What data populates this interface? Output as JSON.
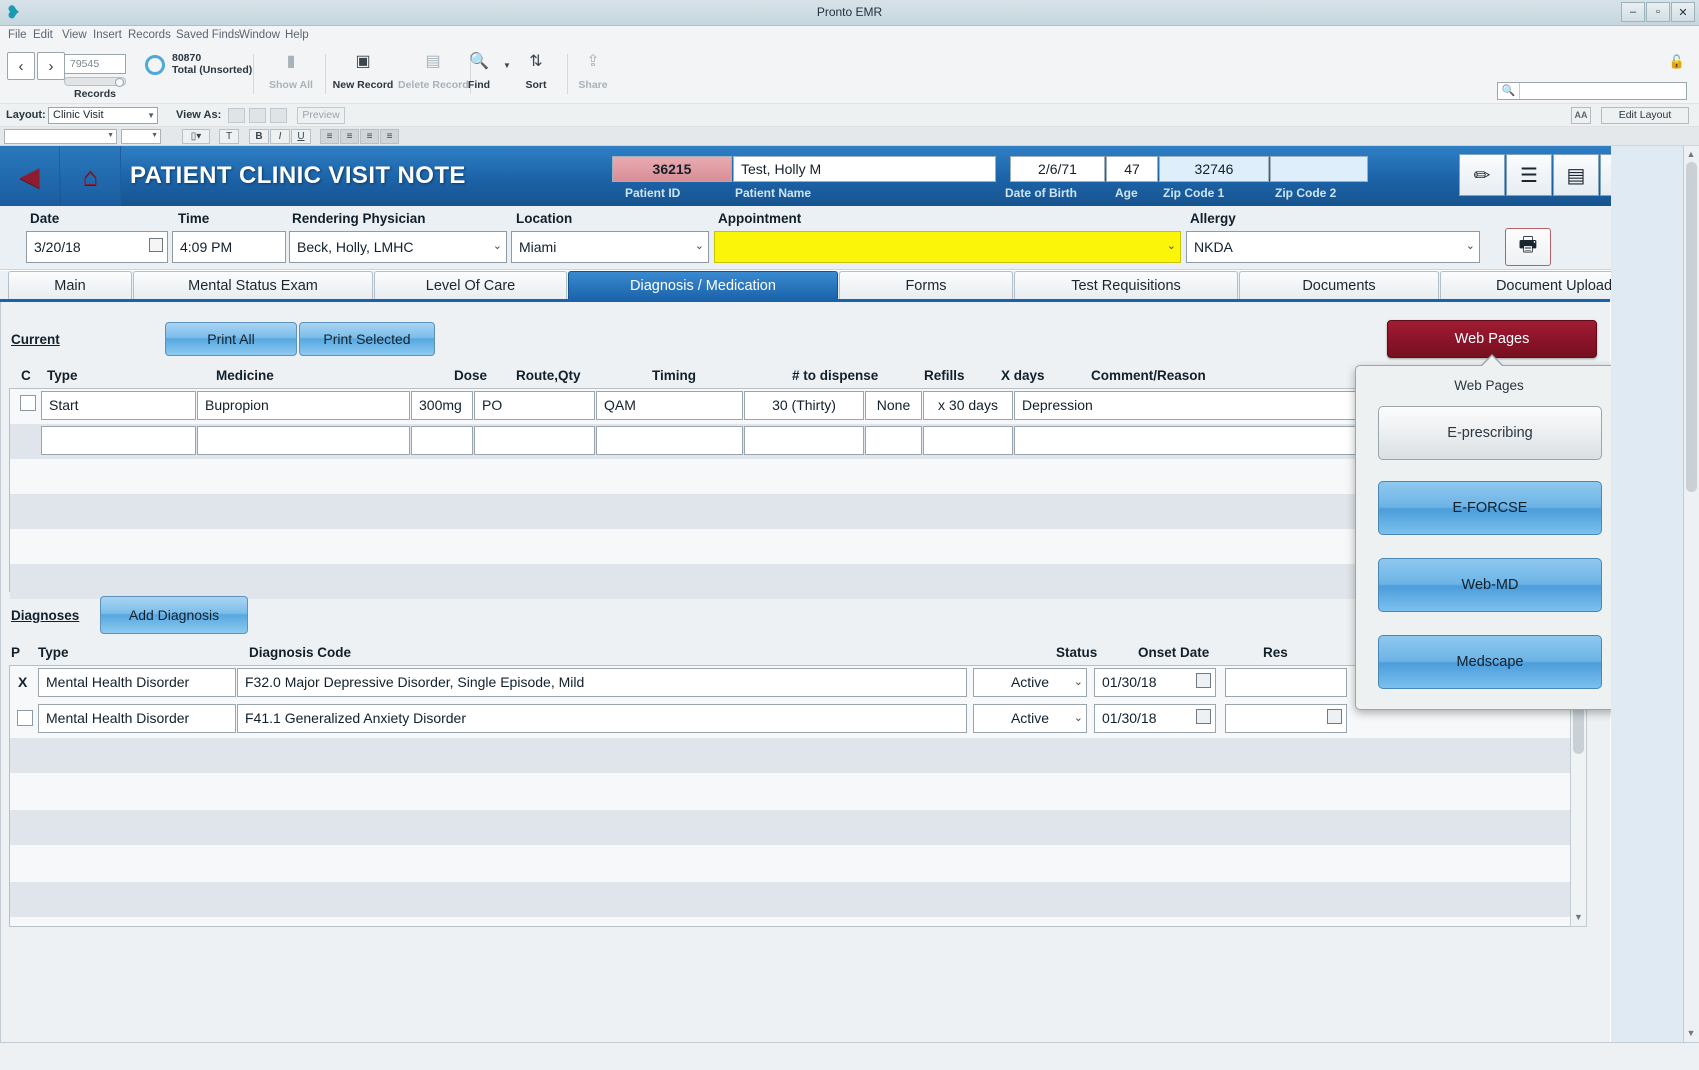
{
  "window": {
    "title": "Pronto EMR",
    "minimize": "–",
    "maximize": "▫",
    "close": "✕"
  },
  "menubar": {
    "items": [
      "File",
      "Edit",
      "View",
      "Insert",
      "Records",
      "Saved Finds",
      "Window",
      "Help"
    ]
  },
  "toolbar": {
    "prev": "‹",
    "next": "›",
    "record_number": "79545",
    "records_label": "Records",
    "total_count": "80870",
    "total_label": "Total (Unsorted)",
    "show_all": "Show All",
    "new_record": "New Record",
    "delete_record": "Delete Record",
    "find": "Find",
    "sort": "Sort",
    "share": "Share",
    "search_value": "",
    "search_placeholder": ""
  },
  "layoutbar": {
    "layout_label": "Layout:",
    "layout_value": "Clinic Visit",
    "view_as_label": "View As:",
    "preview": "Preview",
    "aa": "AA",
    "edit_layout": "Edit Layout"
  },
  "formatbar": {
    "bold": "B",
    "italic": "I",
    "underline": "U",
    "text": "T"
  },
  "header": {
    "title": "PATIENT CLINIC VISIT NOTE",
    "fields": [
      {
        "label": "Patient  ID",
        "value": "36215"
      },
      {
        "label": "Patient Name",
        "value": "Test, Holly M"
      },
      {
        "label": "Date of Birth",
        "value": "2/6/71"
      },
      {
        "label": "Age",
        "value": "47"
      },
      {
        "label": "Zip Code 1",
        "value": "32746"
      },
      {
        "label": "Zip Code 2",
        "value": ""
      }
    ],
    "icons": [
      "pencil-icon",
      "list-icon",
      "id-card-icon",
      "briefcase-icon",
      "report-search-icon"
    ]
  },
  "formrow": {
    "date_label": "Date",
    "date_value": "3/20/18",
    "time_label": "Time",
    "time_value": "4:09 PM",
    "physician_label": "Rendering Physician",
    "physician_value": "Beck, Holly, LMHC",
    "location_label": "Location",
    "location_value": "Miami",
    "appointment_label": "Appointment",
    "appointment_value": "",
    "allergy_label": "Allergy",
    "allergy_value": "NKDA"
  },
  "tabs": [
    {
      "label": "Main",
      "active": false
    },
    {
      "label": "Mental Status Exam",
      "active": false
    },
    {
      "label": "Level Of Care",
      "active": false
    },
    {
      "label": "Diagnosis / Medication",
      "active": true
    },
    {
      "label": "Forms",
      "active": false
    },
    {
      "label": "Test Requisitions",
      "active": false
    },
    {
      "label": "Documents",
      "active": false
    },
    {
      "label": "Document Upload",
      "active": false
    }
  ],
  "medications": {
    "section_label": "Current",
    "print_all": "Print All",
    "print_selected": "Print Selected",
    "web_pages_button": "Web Pages",
    "columns": [
      "C",
      "Type",
      "Medicine",
      "Dose",
      "Route,Qty",
      "Timing",
      "# to dispense",
      "Refills",
      "X days",
      "Comment/Reason"
    ],
    "rows": [
      {
        "checked": false,
        "type": "Start",
        "medicine": "Bupropion",
        "dose": "300mg",
        "route_qty": "PO",
        "timing": "QAM",
        "dispense": "30 (Thirty)",
        "refills": "None",
        "x_days": "x 30 days",
        "comment": "Depression"
      },
      {
        "checked": false,
        "type": "",
        "medicine": "",
        "dose": "",
        "route_qty": "",
        "timing": "",
        "dispense": "",
        "refills": "",
        "x_days": "",
        "comment": ""
      }
    ]
  },
  "diagnoses": {
    "section_label": "Diagnoses",
    "add_button": "Add Diagnosis",
    "columns": [
      "P",
      "Type",
      "Diagnosis Code",
      "Status",
      "Onset Date",
      "Res"
    ],
    "rows": [
      {
        "primary": "X",
        "type": "Mental Health Disorder",
        "code": "F32.0 Major Depressive Disorder, Single Episode, Mild",
        "status": "Active",
        "onset_date": "01/30/18",
        "resolved_date": ""
      },
      {
        "primary": "",
        "type": "Mental Health Disorder",
        "code": "F41.1 Generalized Anxiety Disorder",
        "status": "Active",
        "onset_date": "01/30/18",
        "resolved_date": ""
      }
    ]
  },
  "popover": {
    "title": "Web Pages",
    "buttons": [
      {
        "label": "E-prescribing",
        "style": "grey"
      },
      {
        "label": "E-FORCSE",
        "style": "blue"
      },
      {
        "label": "Web-MD",
        "style": "blue"
      },
      {
        "label": "Medscape",
        "style": "blue"
      }
    ]
  },
  "colors": {
    "header_blue": "#1c63a8",
    "accent_dark_red": "#8a1329",
    "appointment_yellow": "#fbf50a",
    "patient_id_pink": "#d98f97",
    "button_blue": "#7cbdea"
  }
}
